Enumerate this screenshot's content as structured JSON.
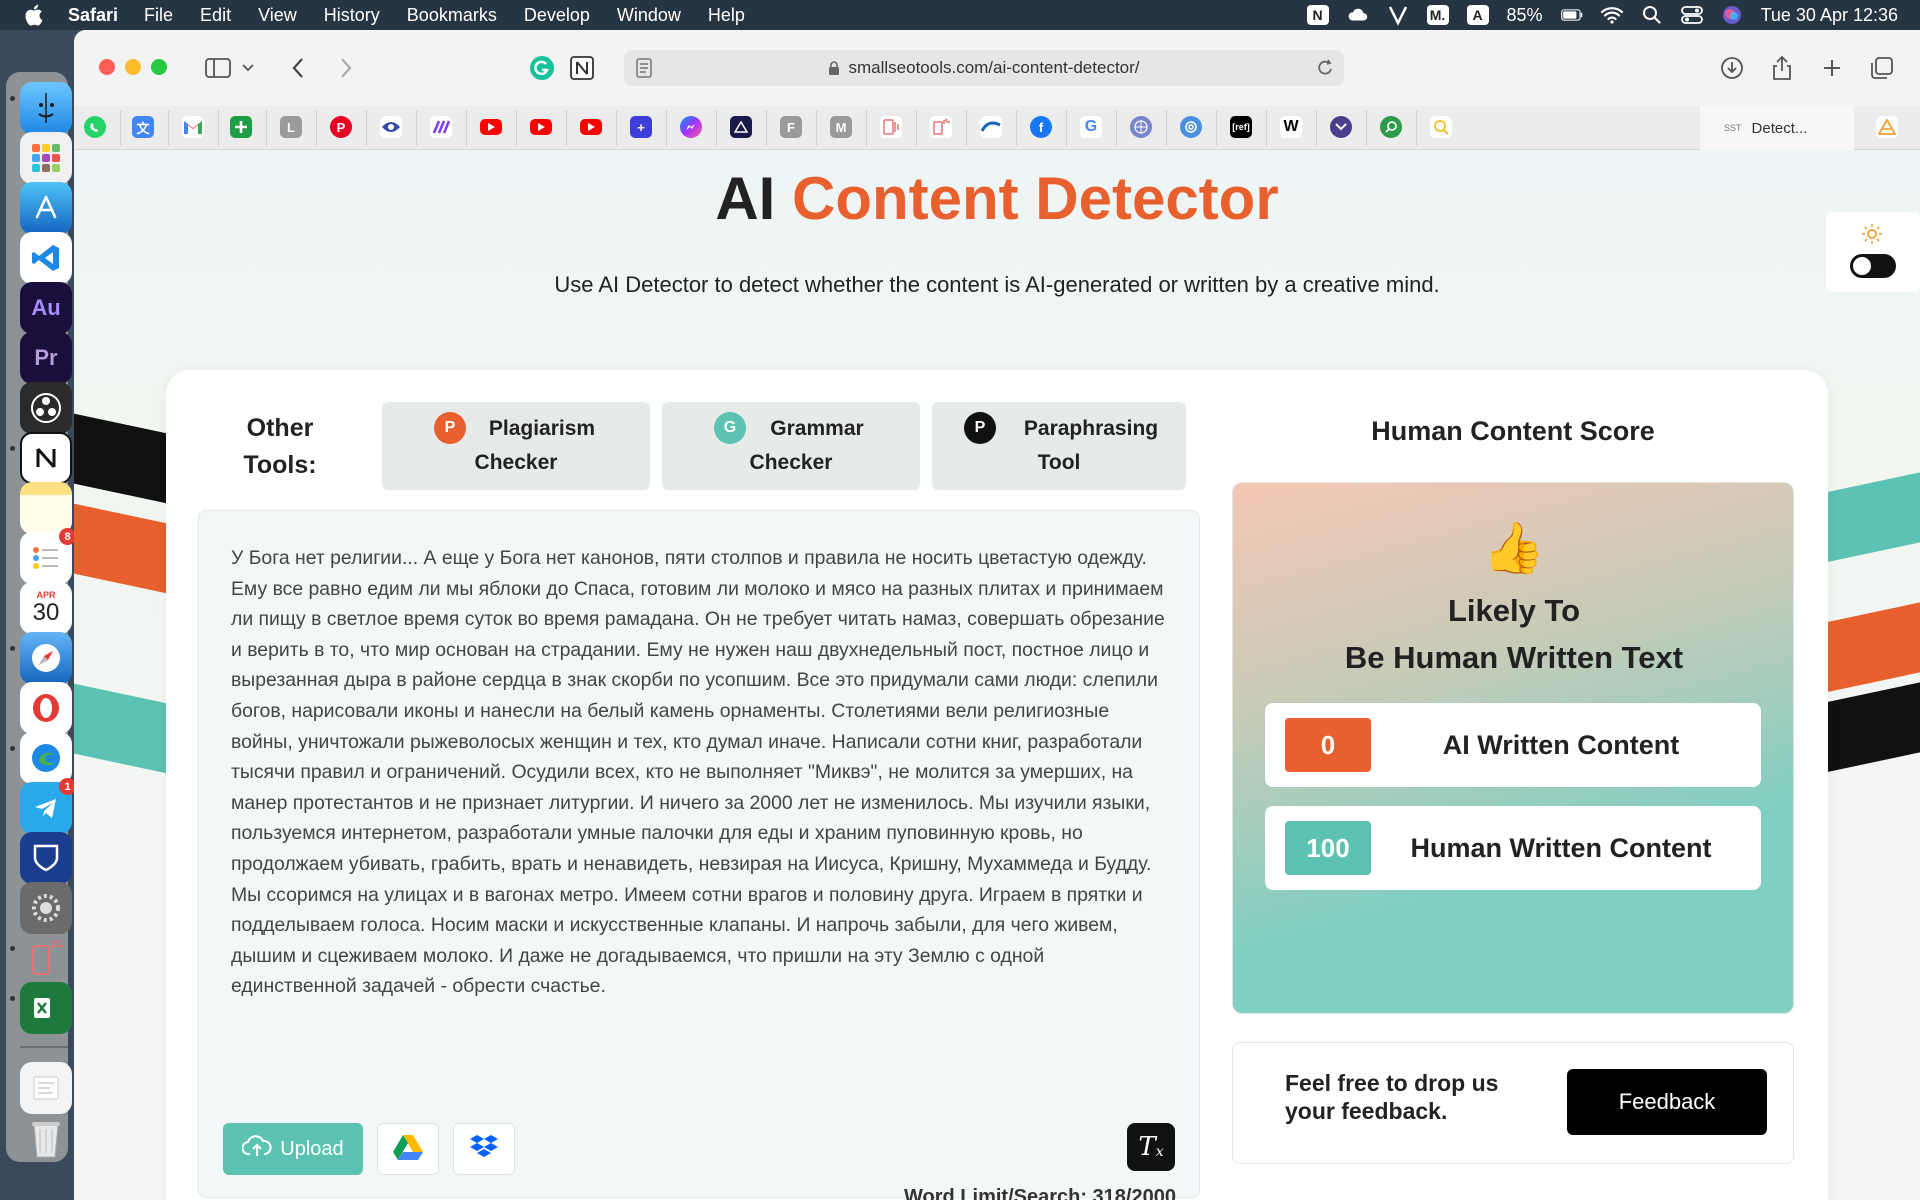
{
  "menubar": {
    "app_name": "Safari",
    "menus": [
      "File",
      "Edit",
      "View",
      "History",
      "Bookmarks",
      "Develop",
      "Window",
      "Help"
    ],
    "battery": "85%",
    "datetime": "Tue 30 Apr  12:36",
    "notion_badge": "N",
    "medium_badge": "M.",
    "a_badge": "A"
  },
  "dock": {
    "calendar_month": "APR",
    "calendar_day": "30",
    "reminders_badge": "8",
    "telegram_badge": "1",
    "au_label": "Au",
    "pr_label": "Pr"
  },
  "browser": {
    "url": "smallseotools.com/ai-content-detector/",
    "active_tab_title": "Detect...",
    "active_tab_favicon": "SST",
    "favorites": [
      "whatsapp",
      "translate",
      "gmail",
      "sheets-add",
      "L",
      "pinterest",
      "eye",
      "bars",
      "youtube",
      "youtube",
      "youtube",
      "plus-square",
      "messenger",
      "triangle",
      "F",
      "M",
      "book",
      "chart",
      "wave",
      "facebook",
      "google",
      "globe",
      "spiral",
      "ref",
      "W",
      "chevron",
      "search",
      "magnifier"
    ]
  },
  "page": {
    "title_part1": "AI",
    "title_part2": "Content Detector",
    "subtitle": "Use AI Detector to detect whether the content is AI-generated or written by a creative mind.",
    "other_tools_label": "Other Tools:",
    "tools": [
      {
        "letter": "P",
        "line1": "Plagiarism",
        "line2": "Checker",
        "color": "#e8602d"
      },
      {
        "letter": "G",
        "line1": "Grammar",
        "line2": "Checker",
        "color": "#5cc2b1"
      },
      {
        "letter": "P",
        "line1": "Paraphrasing",
        "line2": "Tool",
        "color": "#111111"
      }
    ],
    "editor_text": "У Бога нет религии... А еще у Бога нет канонов, пяти столпов и правила не носить цветастую одежду. Ему все равно едим ли мы яблоки до Спаса, готовим ли молоко и мясо на разных плитах и принимаем ли пищу в светлое время суток во время рамадана. Он не требует читать намаз, совершать обрезание и верить в то, что мир основан на страдании. Ему не нужен наш двухнедельный пост, постное лицо и вырезанная дыра в районе сердца в знак скорби по усопшим. Все это придумали сами люди: слепили богов, нарисовали иконы и нанесли на белый камень орнаменты. Столетиями вели религиозные войны, уничтожали рыжеволосых женщин и тех, кто думал иначе. Написали сотни книг, разработали тысячи правил и ограничений. Осудили всех, кто не выполняет \"Миквэ\", не молится за умерших, на манер протестантов и не признает литургии. И ничего за 2000 лет не изменилось. Мы изучили языки, пользуемся интернетом, разработали умные палочки для еды и храним пуповинную кровь, но продолжаем убивать, грабить, врать и ненавидеть, невзирая на Иисуса, Кришну, Мухаммеда и Будду. Мы ссоримся на улицах и в вагонах метро. Имеем сотни врагов и половину друга. Играем в прятки и подделываем голоса. Носим маски и искусственные клапаны. И напрочь забыли, для чего живем, дышим и сцеживаем молоко. И даже не догадываемся, что пришли на эту Землю с одной единственной задачей - обрести счастье.",
    "upload_label": "Upload",
    "word_limit": "Word Limit/Search: 318/2000",
    "score": {
      "title": "Human Content Score",
      "verdict_line1": "Likely To",
      "verdict_line2": "Be Human Written Text",
      "ai_value": "0",
      "ai_label": "AI Written Content",
      "ai_color": "#e8602d",
      "human_value": "100",
      "human_label": "Human Written Content",
      "human_color": "#5cc2b1"
    },
    "feedback_text": "Feel free to drop us your feedback.",
    "feedback_button": "Feedback"
  }
}
